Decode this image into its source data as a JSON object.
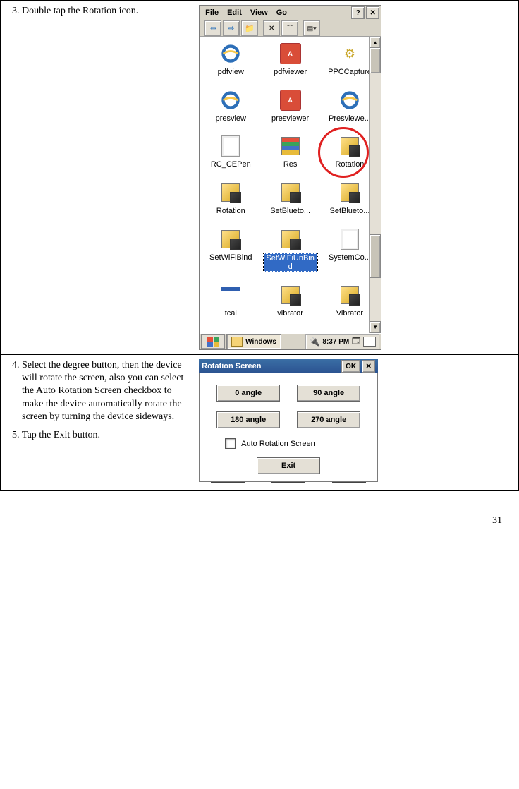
{
  "page_number": "31",
  "step3": {
    "num": "3.",
    "text": "Double tap the Rotation icon."
  },
  "step4": {
    "num": "4.",
    "text": "Select the degree button, then the device will rotate the screen, also you can select the Auto Rotation Screen checkbox to make the device automatically rotate the screen by turning the device sideways."
  },
  "step5": {
    "num": "5.",
    "text": "Tap the  Exit button."
  },
  "explorer": {
    "menu": {
      "file": "File",
      "edit": "Edit",
      "view": "View",
      "go": "Go"
    },
    "help_btn": "?",
    "close_btn": "✕",
    "files": [
      {
        "label": "pdfview",
        "icon": "ie"
      },
      {
        "label": "pdfviewer",
        "icon": "pdf"
      },
      {
        "label": "PPCCapture",
        "icon": "gear"
      },
      {
        "label": "presview",
        "icon": "ie"
      },
      {
        "label": "presviewer",
        "icon": "pdf"
      },
      {
        "label": "Presviewe...",
        "icon": "ie"
      },
      {
        "label": "RC_CEPen",
        "icon": "doc"
      },
      {
        "label": "Res",
        "icon": "flag"
      },
      {
        "label": "Rotation",
        "icon": "box"
      },
      {
        "label": "Rotation",
        "icon": "box"
      },
      {
        "label": "SetBlueto...",
        "icon": "box"
      },
      {
        "label": "SetBlueto...",
        "icon": "box"
      },
      {
        "label": "SetWiFiBind",
        "icon": "box"
      },
      {
        "label": "SetWiFiUnBind",
        "icon": "box",
        "selected": true
      },
      {
        "label": "SystemCo...",
        "icon": "doc"
      },
      {
        "label": "tcal",
        "icon": "window"
      },
      {
        "label": "vibrator",
        "icon": "box"
      },
      {
        "label": "Vibrator",
        "icon": "box"
      }
    ],
    "task_label": "Windows",
    "tray_time": "8:37 PM"
  },
  "rotation": {
    "title": "Rotation Screen",
    "ok": "OK",
    "close": "✕",
    "angles": [
      "0 angle",
      "90 angle",
      "180 angle",
      "270 angle"
    ],
    "checkbox_label": "Auto Rotation Screen",
    "exit": "Exit"
  }
}
